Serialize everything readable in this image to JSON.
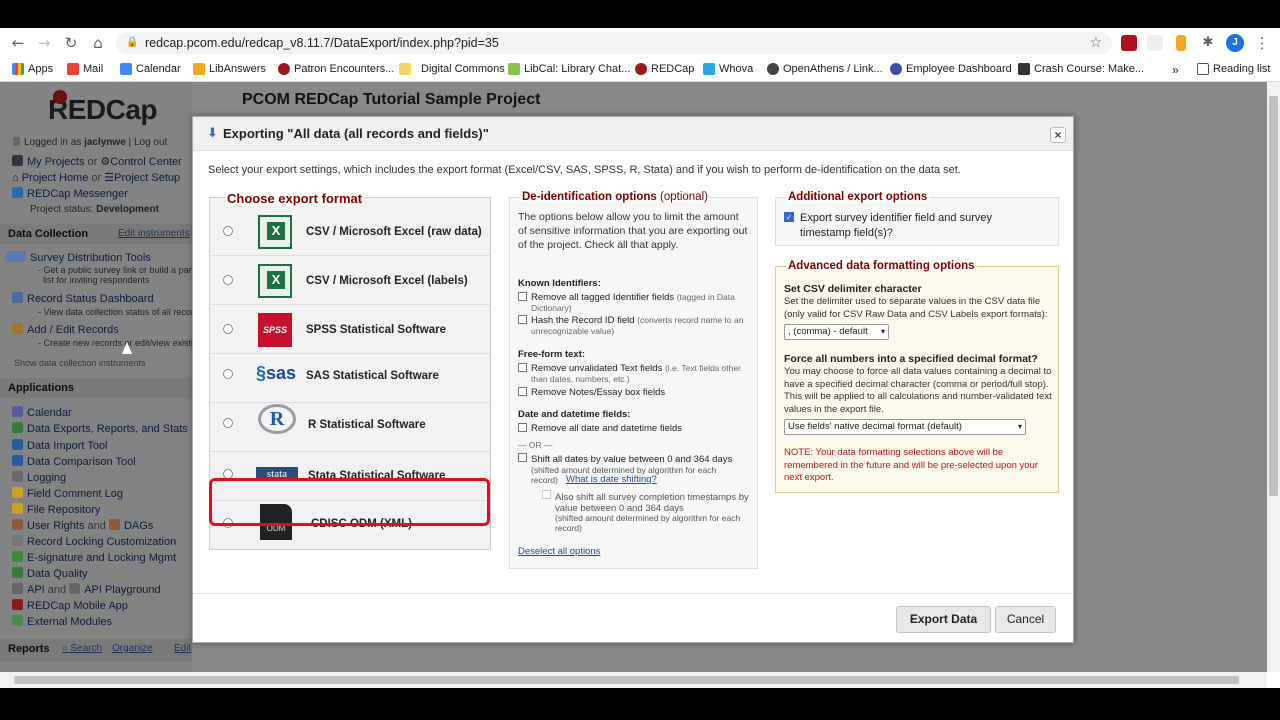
{
  "browser": {
    "url": "redcap.pcom.edu/redcap_v8.11.7/DataExport/index.php?pid=35",
    "profile_initial": "J",
    "bookmarks": [
      "Apps",
      "Mail",
      "Calendar",
      "LibAnswers",
      "Patron Encounters...",
      "Digital Commons",
      "LibCal: Library Chat...",
      "REDCap",
      "Whova",
      "OpenAthens / Link...",
      "Employee Dashboard",
      "Crash Course: Make..."
    ],
    "more": "»",
    "reading_list": "Reading list"
  },
  "project_title": "PCOM REDCap Tutorial Sample Project",
  "sidebar": {
    "logo": "REDCap",
    "logged_in_prefix": "Logged in as",
    "username": "jaclynwe",
    "separator": "|",
    "logout": "Log out",
    "my_projects": "My Projects",
    "or": "or",
    "control_center": "Control Center",
    "project_home": "Project Home",
    "project_setup": "Project Setup",
    "messenger": "REDCap Messenger",
    "status_label": "Project status:",
    "status_value": "Development",
    "data_collection_header": "Data Collection",
    "edit_instruments": "Edit instruments",
    "survey_tools": "Survey Distribution Tools",
    "survey_tools_sub1": "- Get a public survey link or build a participant",
    "survey_tools_sub2": "list for inviting respondents",
    "record_status": "Record Status Dashboard",
    "record_status_sub": "- View data collection status of all records",
    "add_edit": "Add / Edit Records",
    "add_edit_sub": "- Create new records or edit/view existing ones",
    "show_instruments": "Show data collection instruments",
    "applications_header": "Applications",
    "apps": [
      "Calendar",
      "Data Exports, Reports, and Stats",
      "Data Import Tool",
      "Data Comparison Tool",
      "Logging",
      "Field Comment Log",
      "File Repository",
      "User Rights",
      "Record Locking Customization",
      "E-signature and Locking Mgmt",
      "Data Quality",
      "API",
      "REDCap Mobile App",
      "External Modules"
    ],
    "and": "and",
    "dags": "DAGs",
    "api_playground": "API Playground",
    "reports_header": "Reports",
    "reports_search": "Search",
    "reports_organize": "Organize",
    "reports_edit": "Edit"
  },
  "modal": {
    "title": "Exporting \"All data (all records and fields)\"",
    "close": "×",
    "description": "Select your export settings, which includes the export format (Excel/CSV, SAS, SPSS, R, Stata) and if you wish to perform de-identification on the data set.",
    "format_header": "Choose export format",
    "formats": [
      {
        "label": "CSV / Microsoft Excel (raw data)",
        "icon": "excel-icon"
      },
      {
        "label": "CSV / Microsoft Excel (labels)",
        "icon": "excel-icon"
      },
      {
        "label": "SPSS Statistical Software",
        "icon": "spss-icon"
      },
      {
        "label": "SAS Statistical Software",
        "icon": "sas-icon"
      },
      {
        "label": "R Statistical Software",
        "icon": "r-icon"
      },
      {
        "label": "Stata Statistical Software",
        "icon": "stata-icon"
      },
      {
        "label": "CDISC ODM (XML)",
        "icon": "odm-icon"
      }
    ],
    "icon_text": {
      "spss": "SPSS",
      "sas": "sas",
      "r": "R",
      "stata": "stata",
      "odm": "ODM"
    },
    "deid": {
      "header": "De-identification options",
      "header_opt": "(optional)",
      "intro": "The options below allow you to limit the amount of sensitive information that you are exporting out of the project. Check all that apply.",
      "known_header": "Known Identifiers:",
      "opt_remove_ident": "Remove all tagged Identifier fields",
      "opt_remove_ident_note": "(tagged in Data Dictionary)",
      "opt_hash": "Hash the Record ID field",
      "opt_hash_note": "(converts record name to an unrecognizable value)",
      "freeform_header": "Free-form text:",
      "opt_unvalidated": "Remove unvalidated Text fields",
      "opt_unvalidated_note": "(i.e. Text fields other than dates, numbers, etc.)",
      "opt_notes": "Remove Notes/Essay box fields",
      "date_header": "Date and datetime fields:",
      "opt_remove_dates": "Remove all date and datetime fields",
      "or_sep": "— OR —",
      "opt_shift": "Shift all dates by value between 0 and 364 days",
      "opt_shift_note": "(shifted amount determined by algorithm for each record)",
      "what_is_shift": "What is date shifting?",
      "opt_shift_survey": "Also shift all survey completion timestamps by value between 0 and 364 days",
      "opt_shift_survey_note": "(shifted amount determined by algorithm for each record)",
      "deselect": "Deselect all options"
    },
    "additional": {
      "header": "Additional export options",
      "checkbox_label": "Export survey identifier field and survey timestamp field(s)?",
      "checked": true
    },
    "advanced": {
      "header": "Advanced data formatting options",
      "delim_header": "Set CSV delimiter character",
      "delim_desc": "Set the delimiter used to separate values in the CSV data file (only valid for CSV Raw Data and CSV Labels export formats):",
      "delim_value": ", (comma) - default",
      "decimal_header": "Force all numbers into a specified decimal format?",
      "decimal_desc": "You may choose to force all data values containing a decimal to have a specified decimal character (comma or period/full stop). This will be applied to all calculations and number-validated text values in the export file.",
      "decimal_value": "Use fields' native decimal format (default)",
      "note": "NOTE: Your data formatting selections above will be remembered in the future and will be pre-selected upon your next export."
    },
    "export_button": "Export Data",
    "cancel_button": "Cancel"
  },
  "colors": {
    "maroon": "#800000",
    "highlight": "#e0101a",
    "excel": "#1d6f42"
  }
}
